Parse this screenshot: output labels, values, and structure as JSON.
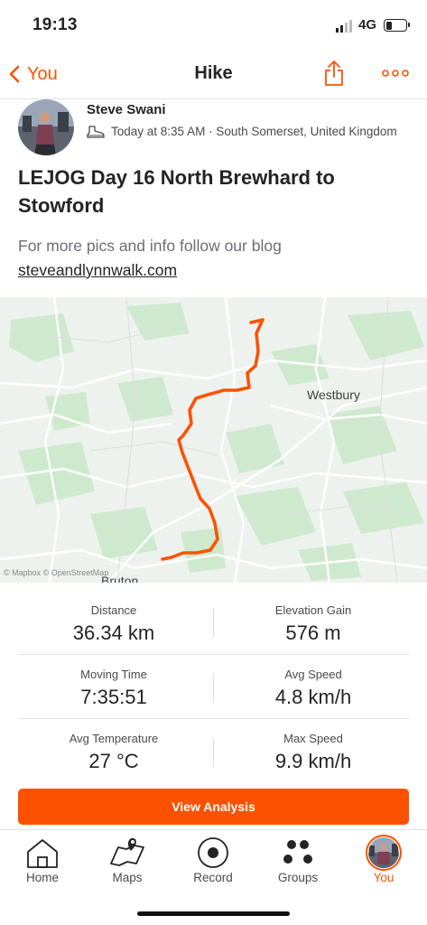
{
  "status_bar": {
    "time": "19:13",
    "network": "4G",
    "battery_level": 0.3
  },
  "nav": {
    "back_label": "You",
    "title": "Hike"
  },
  "activity": {
    "athlete_name": "Steve Swani",
    "meta": "Today at 8:35 AM · South Somerset, United Kingdom",
    "title": "LEJOG Day 16 North Brewhard to Stowford",
    "description": "For more pics and info follow our blog",
    "link": "steveandlynnwalk.com"
  },
  "map": {
    "labels": {
      "westbury": "Westbury",
      "bruton": "Bruton",
      "attribution": "© Mapbox © OpenStreetMap"
    },
    "route_color": "#fc5200"
  },
  "stats": [
    {
      "label": "Distance",
      "value": "36.34 km"
    },
    {
      "label": "Elevation Gain",
      "value": "576 m"
    },
    {
      "label": "Moving Time",
      "value": "7:35:51"
    },
    {
      "label": "Avg Speed",
      "value": "4.8 km/h"
    },
    {
      "label": "Avg Temperature",
      "value": "27 °C"
    },
    {
      "label": "Max Speed",
      "value": "9.9 km/h"
    }
  ],
  "analysis_button": "View Analysis",
  "tabs": [
    {
      "label": "Home",
      "icon": "home-icon"
    },
    {
      "label": "Maps",
      "icon": "map-icon"
    },
    {
      "label": "Record",
      "icon": "record-icon"
    },
    {
      "label": "Groups",
      "icon": "groups-icon"
    },
    {
      "label": "You",
      "icon": "avatar",
      "active": true
    }
  ],
  "colors": {
    "accent": "#fc5200",
    "text": "#242428",
    "muted": "#6d6d78"
  }
}
